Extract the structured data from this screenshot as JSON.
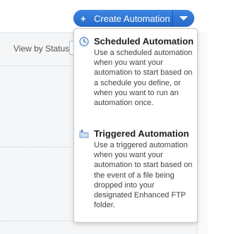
{
  "header": {
    "create_button_label": "Create Automation",
    "create_button_icon": "plus-icon",
    "caret_icon": "chevron-down-icon",
    "accent_color": "#2b74d4"
  },
  "filter": {
    "view_by_label": "View by Status"
  },
  "menu": {
    "items": [
      {
        "title": "Scheduled Automation",
        "description": "Use a scheduled automation when you want your automation to start based on a schedule you define, or when you want to run an automation once.",
        "icon": "clock-icon"
      },
      {
        "title": "Triggered Automation",
        "description": "Use a triggered automation when you want your automation to start based on the event of a file being dropped into your designated Enhanced FTP folder.",
        "icon": "folder-icon"
      }
    ]
  }
}
